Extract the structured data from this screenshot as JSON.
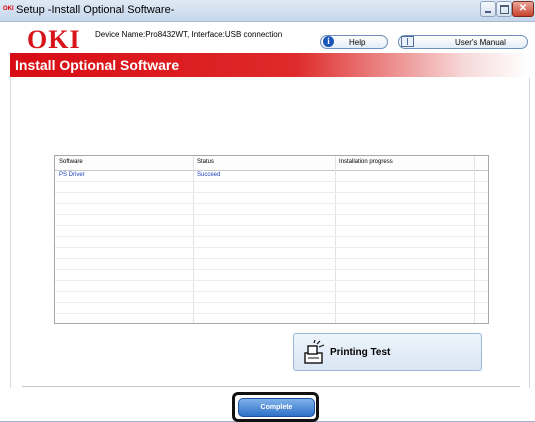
{
  "window": {
    "logo_small": "OKI",
    "title": "Setup -Install Optional Software-"
  },
  "header": {
    "logo": "OKI",
    "device_info": "Device Name:Pro8432WT, Interface:USB connection",
    "help_label": "Help",
    "manual_label": "User's Manual"
  },
  "banner": {
    "title": "Install Optional Software"
  },
  "table": {
    "columns": [
      "Software",
      "Status",
      "Installation progress"
    ],
    "rows": [
      {
        "software": "PS Driver",
        "status": "Succeed",
        "progress": ""
      }
    ]
  },
  "buttons": {
    "printing_test": "Printing Test",
    "complete": "Complete"
  },
  "colors": {
    "brand_red": "#d8141b",
    "link_blue": "#1b3fbf",
    "button_blue": "#2f71c8"
  }
}
